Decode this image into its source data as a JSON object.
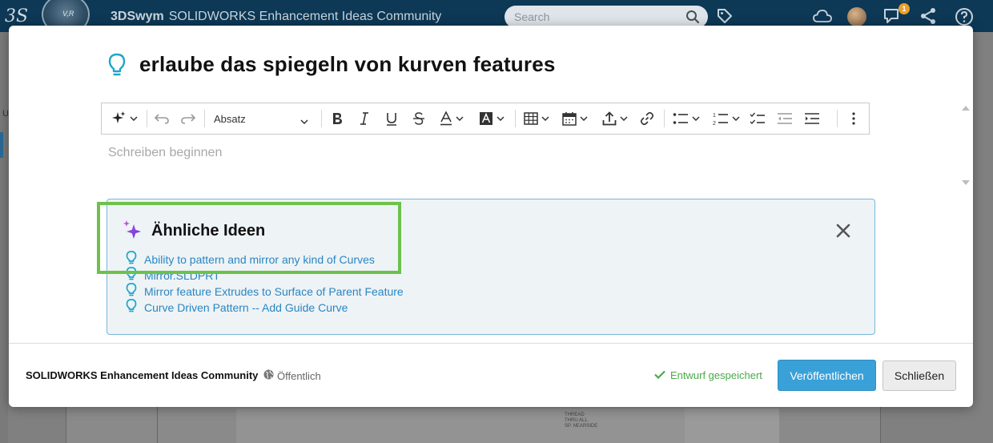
{
  "app": {
    "brand": "3DSwym",
    "community_name": "SOLIDWORKS Enhancement Ideas Community",
    "search_placeholder": "Search",
    "notification_count": "1",
    "bg_left_letter": "U",
    "compass_label": "V,R"
  },
  "background_drawing": {
    "lines": [
      "THREAD",
      "THRU ALL",
      "SP. NEARSIDE"
    ]
  },
  "modal": {
    "title": "erlaube das spiegeln von kurven features",
    "editor": {
      "placeholder": "Schreiben beginnen",
      "paragraph_style": "Absatz",
      "toolbar_icons": [
        "ai-assistant-icon",
        "undo-icon",
        "redo-icon",
        "bold-icon",
        "italic-icon",
        "underline-icon",
        "strikethrough-icon",
        "font-color-icon",
        "highlight-color-icon",
        "table-icon",
        "calendar-icon",
        "upload-icon",
        "link-icon",
        "bulleted-list-icon",
        "numbered-list-icon",
        "checklist-icon",
        "outdent-icon",
        "indent-icon",
        "more-options-icon"
      ]
    },
    "similar_ideas": {
      "title": "Ähnliche Ideen",
      "items": [
        {
          "label": "Ability to pattern and mirror any kind of Curves"
        },
        {
          "label": "Mirror.SLDPRT"
        },
        {
          "label": "Mirror feature Extrudes to Surface of Parent Feature"
        },
        {
          "label": "Curve Driven Pattern -- Add Guide Curve"
        }
      ]
    },
    "footer": {
      "community": "SOLIDWORKS Enhancement Ideas Community",
      "visibility": "Öffentlich",
      "draft_status": "Entwurf gespeichert",
      "publish_label": "Veröffentlichen",
      "close_label": "Schließen"
    }
  },
  "colors": {
    "topbar": "#0d3856",
    "accent_blue": "#3aa0d8",
    "link_blue": "#2a86c2",
    "idea_icon": "#1ea7c9",
    "saved_green": "#4aa94a",
    "highlight_green": "#6cc24a",
    "sparkle_purple": "#7b3fe4"
  }
}
